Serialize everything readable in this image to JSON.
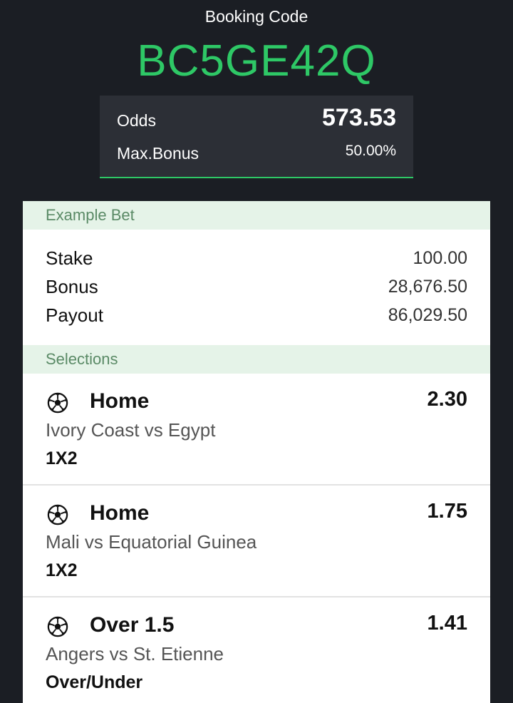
{
  "header": {
    "booking_label": "Booking Code",
    "booking_code": "BC5GE42Q",
    "odds_label": "Odds",
    "odds_value": "573.53",
    "max_bonus_label": "Max.Bonus",
    "max_bonus_value": "50.00%"
  },
  "example_bet": {
    "title": "Example Bet",
    "rows": [
      {
        "label": "Stake",
        "value": "100.00"
      },
      {
        "label": "Bonus",
        "value": "28,676.50"
      },
      {
        "label": "Payout",
        "value": "86,029.50"
      }
    ]
  },
  "selections": {
    "title": "Selections",
    "items": [
      {
        "pick": "Home",
        "odd": "2.30",
        "match": "Ivory Coast vs Egypt",
        "market": "1X2",
        "icon": "soccer-ball-icon"
      },
      {
        "pick": "Home",
        "odd": "1.75",
        "match": "Mali vs Equatorial Guinea",
        "market": "1X2",
        "icon": "soccer-ball-icon"
      },
      {
        "pick": "Over 1.5",
        "odd": "1.41",
        "match": "Angers vs St. Etienne",
        "market": "Over/Under",
        "icon": "soccer-ball-icon"
      }
    ]
  },
  "colors": {
    "background": "#1b1e24",
    "accent": "#2ec866",
    "section_header_bg": "#e5f3e8",
    "section_header_text": "#5a8a66"
  }
}
